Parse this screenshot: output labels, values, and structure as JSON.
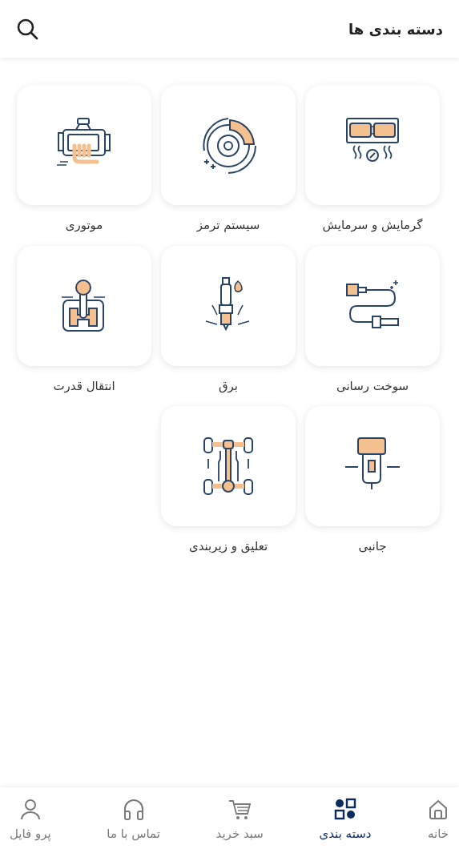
{
  "header": {
    "title": "دسته بندی ها"
  },
  "categories": [
    {
      "kind": "hvac",
      "label": "گرمایش و سرمایش"
    },
    {
      "kind": "brake",
      "label": "سیستم ترمز"
    },
    {
      "kind": "engine",
      "label": "موتوری"
    },
    {
      "kind": "fuel",
      "label": "سوخت رسانی"
    },
    {
      "kind": "spark",
      "label": "برق"
    },
    {
      "kind": "gearbox",
      "label": "انتقال قدرت"
    },
    {
      "kind": "charger",
      "label": "جانبی"
    },
    {
      "kind": "chassis",
      "label": "تعلیق و زیربندی"
    }
  ],
  "bottom_nav": [
    {
      "kind": "home",
      "label": "خانه",
      "selected": false
    },
    {
      "kind": "grid",
      "label": "دسته بندی",
      "selected": true
    },
    {
      "kind": "cart",
      "label": "سبد خرید",
      "selected": false
    },
    {
      "kind": "headset",
      "label": "تماس با ما",
      "selected": false
    },
    {
      "kind": "user",
      "label": "پرو فایل",
      "selected": false
    }
  ]
}
